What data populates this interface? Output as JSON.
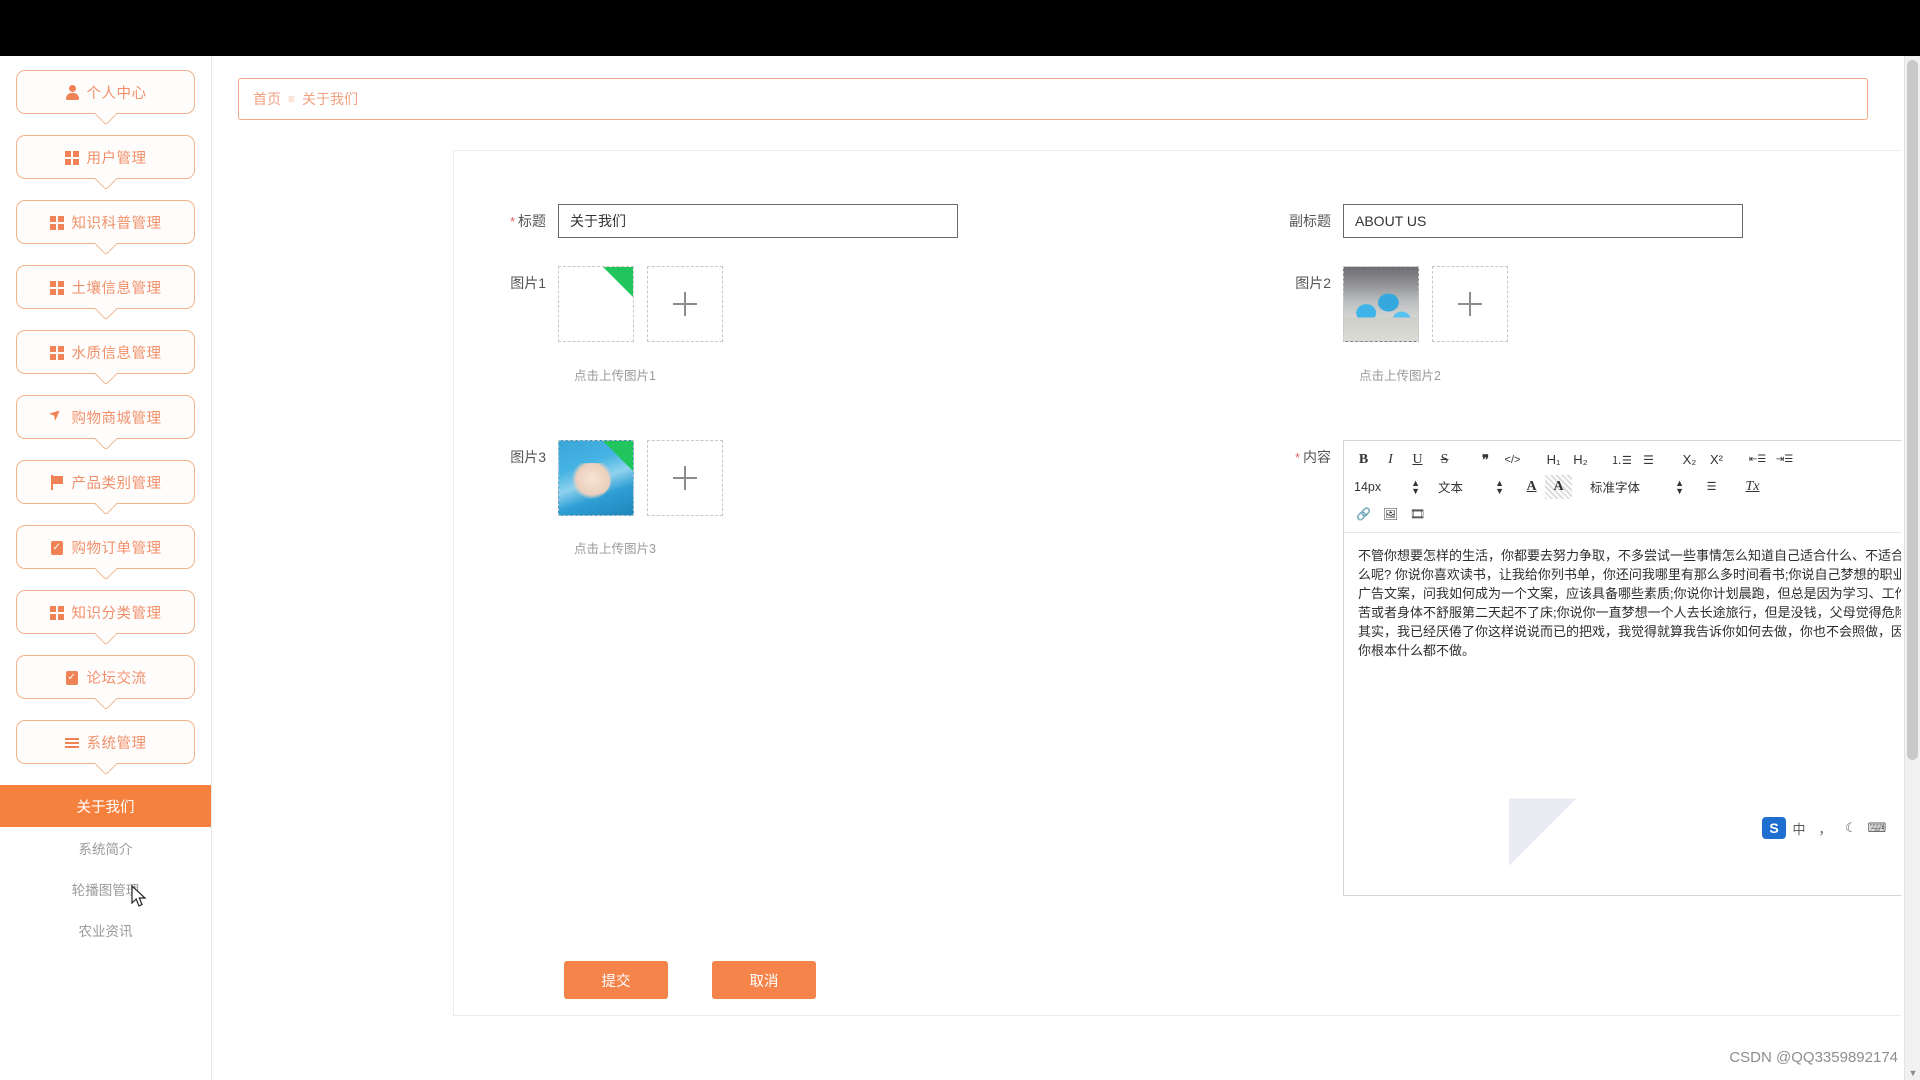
{
  "window": {
    "credit": "CSDN @QQ3359892174"
  },
  "sidebar": {
    "items": [
      {
        "label": "个人中心",
        "icon": "person-icon"
      },
      {
        "label": "用户管理",
        "icon": "grid-icon"
      },
      {
        "label": "知识科普管理",
        "icon": "grid-icon"
      },
      {
        "label": "土壤信息管理",
        "icon": "grid-icon"
      },
      {
        "label": "水质信息管理",
        "icon": "grid-icon"
      },
      {
        "label": "购物商城管理",
        "icon": "paper-plane-icon"
      },
      {
        "label": "产品类别管理",
        "icon": "flag-icon"
      },
      {
        "label": "购物订单管理",
        "icon": "clipboard-icon"
      },
      {
        "label": "知识分类管理",
        "icon": "grid-icon"
      },
      {
        "label": "论坛交流",
        "icon": "clipboard-check-icon"
      },
      {
        "label": "系统管理",
        "icon": "lines-icon"
      }
    ],
    "active_item": {
      "label": "关于我们"
    },
    "sub_items": [
      {
        "label": "系统简介"
      },
      {
        "label": "轮播图管理"
      },
      {
        "label": "农业资讯"
      }
    ]
  },
  "breadcrumb": {
    "home": "首页",
    "separator": "≡",
    "current": "关于我们"
  },
  "form": {
    "title_label": "标题",
    "title_value": "关于我们",
    "title_required": "*",
    "subtitle_label": "副标题",
    "subtitle_value": "ABOUT US",
    "image1_label": "图片1",
    "image1_hint": "点击上传图片1",
    "image2_label": "图片2",
    "image2_hint": "点击上传图片2",
    "image3_label": "图片3",
    "image3_hint": "点击上传图片3",
    "content_label": "内容",
    "content_required": "*",
    "content_value": "不管你想要怎样的生活，你都要去努力争取，不多尝试一些事情怎么知道自己适合什么、不适合什么呢? 你说你喜欢读书，让我给你列书单，你还问我哪里有那么多时间看书;你说自己梦想的职业是广告文案，问我如何成为一个文案，应该具备哪些素质;你说你计划晨跑，但总是因为学习、工作辛苦或者身体不舒服第二天起不了床;你说你一直梦想一个人去长途旅行，但是没钱，父母觉得危险。其实，我已经厌倦了你这样说说而已的把戏，我觉得就算我告诉你如何去做，你也不会照做，因为你根本什么都不做。",
    "submit_label": "提交",
    "cancel_label": "取消"
  },
  "editor_toolbar": {
    "row1": [
      {
        "name": "bold-icon",
        "glyph": "B"
      },
      {
        "name": "italic-icon",
        "glyph": "I"
      },
      {
        "name": "underline-icon",
        "glyph": "U"
      },
      {
        "name": "strikethrough-icon",
        "glyph": "S"
      },
      {
        "name": "blockquote-icon",
        "glyph": "❞"
      },
      {
        "name": "code-icon",
        "glyph": "</>"
      },
      {
        "name": "heading1-icon",
        "glyph": "H₁"
      },
      {
        "name": "heading2-icon",
        "glyph": "H₂"
      },
      {
        "name": "ordered-list-icon",
        "glyph": "⒈☰"
      },
      {
        "name": "unordered-list-icon",
        "glyph": "☰"
      },
      {
        "name": "subscript-icon",
        "glyph": "X₂"
      },
      {
        "name": "superscript-icon",
        "glyph": "X²"
      },
      {
        "name": "outdent-icon",
        "glyph": "⇤☰"
      },
      {
        "name": "indent-icon",
        "glyph": "⇥☰"
      }
    ],
    "font_size_value": "14px",
    "text_style_value": "文本",
    "font_family_value": "标准字体",
    "row2_icons": [
      {
        "name": "text-color-icon",
        "glyph": "A"
      },
      {
        "name": "highlight-color-icon",
        "glyph": "A"
      },
      {
        "name": "align-icon",
        "glyph": "☰"
      },
      {
        "name": "clear-format-icon",
        "glyph": "Tx"
      }
    ],
    "row3": [
      {
        "name": "link-icon",
        "glyph": "🔗"
      },
      {
        "name": "insert-image-icon",
        "glyph": "🖼"
      },
      {
        "name": "insert-video-icon",
        "glyph": "🎞"
      }
    ]
  },
  "ime": {
    "logo": "S",
    "mode": "中",
    "punct": "，",
    "moon": "☾",
    "keyboard": "⌨"
  },
  "colors": {
    "accent": "#f5813f",
    "accent_light": "#f0906b",
    "menu_border": "#f0b48c",
    "breadcrumb": "#f2a183"
  }
}
